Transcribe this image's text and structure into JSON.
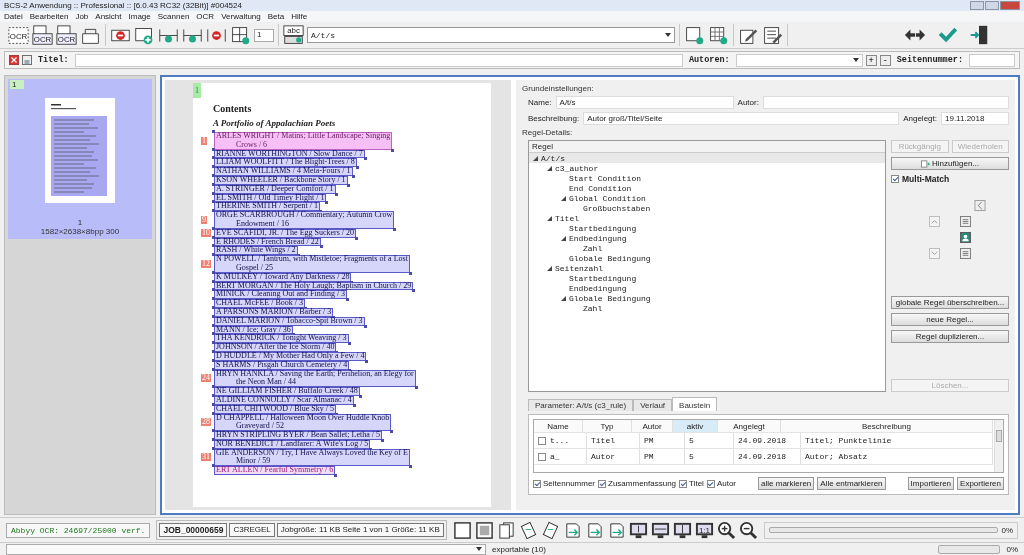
{
  "window": {
    "title": "BCS-2 Anwendung :: Professional :: [6.0.43 RC32 (32Bit)] #004524"
  },
  "menu": [
    "Datei",
    "Bearbeiten",
    "Job",
    "Ansicht",
    "Image",
    "Scannen",
    "OCR",
    "Verwaltung",
    "Beta",
    "Hilfe"
  ],
  "toolbar": {
    "groups": [
      [
        {
          "kind": "ocr-frame",
          "text": "OCR"
        },
        {
          "kind": "ocr-page",
          "text": "OCR"
        },
        {
          "kind": "ocr-page",
          "text": "OCR"
        },
        {
          "kind": "tray"
        }
      ],
      [
        {
          "kind": "region-minus"
        },
        {
          "kind": "region-plus"
        },
        {
          "kind": "region-right"
        },
        {
          "kind": "region-left"
        },
        {
          "kind": "region-stop"
        },
        {
          "kind": "region-grid"
        }
      ],
      [
        {
          "kind": "abc",
          "text": "abc"
        }
      ],
      [
        {
          "kind": "region-add"
        },
        {
          "kind": "grid-play"
        }
      ],
      [
        {
          "kind": "pencil"
        },
        {
          "kind": "list-edit"
        }
      ]
    ],
    "spinner": "1",
    "combo": "A/t/s",
    "right": [
      {
        "kind": "swap"
      },
      {
        "kind": "check"
      },
      {
        "kind": "exit"
      }
    ]
  },
  "title_row": {
    "title_label": "Titel:",
    "authors_label": "Autoren:",
    "plus": "+",
    "minus": "-",
    "page_label": "Seitennummer:"
  },
  "thumbnails": [
    {
      "tag": "1",
      "number": "1",
      "info": "1582×2638×8bpp 300",
      "selected": true
    }
  ],
  "page": {
    "marker": "1",
    "heading": "Contents",
    "subtitle": "A Portfolio of Appalachian Poets",
    "entries": [
      {
        "lines": [
          "ARLES WRIGHT / Matins; Little Landscape; Singing",
          "Crows / 6"
        ],
        "badge": "1",
        "selected": true,
        "flagged": false
      },
      {
        "lines": [
          "RIANNE WORTHINGTON / Slow Dance / 7"
        ],
        "selected": false,
        "flagged": false
      },
      {
        "lines": [
          "LLIAM WOOLFITT / The Blight-Trees / 8"
        ],
        "selected": false,
        "flagged": false
      },
      {
        "lines": [
          "NATHAN WILLIAMS / 4 Meta-Fours / 1"
        ],
        "selected": false,
        "flagged": false
      },
      {
        "lines": [
          "KSON WHEELER / Backbone Story / 1"
        ],
        "selected": false,
        "flagged": false
      },
      {
        "lines": [
          "A. STRINGER / Deeper Comfort / 1"
        ],
        "selected": false,
        "flagged": false
      },
      {
        "lines": [
          "EL SMITH / Old Timey Flight / 1"
        ],
        "selected": false,
        "flagged": false
      },
      {
        "lines": [
          "THERINE SMITH / Serpent / 1"
        ],
        "selected": false,
        "flagged": false
      },
      {
        "lines": [
          "ORGE SCARBROUGH / Commentary; Autumn Crow",
          "Endowment / 16"
        ],
        "badge": "9",
        "selected": false,
        "flagged": false
      },
      {
        "lines": [
          "EVE SCAFIDI, JR. / The Egg Suckers / 20"
        ],
        "badge": "10",
        "selected": false,
        "flagged": false
      },
      {
        "lines": [
          "E RHODES / French Bread / 22"
        ],
        "selected": false,
        "flagged": false
      },
      {
        "lines": [
          "RASH / White Wings / 2"
        ],
        "selected": false,
        "flagged": false
      },
      {
        "lines": [
          "N POWELL / Tantrum, with Mistletoe; Fragments of a Lost",
          "Gospel / 25"
        ],
        "badge": "12",
        "selected": false,
        "flagged": false
      },
      {
        "lines": [
          "K MULKEY / Toward Any Darkness / 28"
        ],
        "selected": false,
        "flagged": false
      },
      {
        "lines": [
          "BERT MORGAN / The Holy Laugh; Baptism in Church / 29"
        ],
        "selected": false,
        "flagged": false
      },
      {
        "lines": [
          "MINICK / Cleaning Out and Finding / 3"
        ],
        "selected": false,
        "flagged": false
      },
      {
        "lines": [
          "CHAEL McFEE / Book / 3"
        ],
        "selected": false,
        "flagged": false
      },
      {
        "lines": [
          "A PARSONS MARION / Barber / 3"
        ],
        "selected": false,
        "flagged": false
      },
      {
        "lines": [
          "DANIEL MARION / Tobacco-Spit Brown / 3"
        ],
        "selected": false,
        "flagged": false
      },
      {
        "lines": [
          "MANN / Ice; Gray / 36"
        ],
        "selected": false,
        "flagged": false
      },
      {
        "lines": [
          "THA KENDRICK / Tonight Weaving / 3"
        ],
        "selected": false,
        "flagged": false
      },
      {
        "lines": [
          "JOHNSON / After the Ice Storm / 40"
        ],
        "selected": false,
        "flagged": false
      },
      {
        "lines": [
          "D HUDDLE / My Mother Had Only a Few / 4"
        ],
        "selected": false,
        "flagged": false
      },
      {
        "lines": [
          "S HARMS / Pisgah Church Cemetery / 4"
        ],
        "selected": false,
        "flagged": false
      },
      {
        "lines": [
          "HRYN HANKLA / Saving the Earth; Perihelion, an Elegy for",
          "the Neon Man / 44"
        ],
        "badge": "24",
        "selected": false,
        "flagged": false
      },
      {
        "lines": [
          "NE GILLIAM FISHER / Buffalo Creek / 48"
        ],
        "selected": false,
        "flagged": false
      },
      {
        "lines": [
          "ALDINE CONNOLLY / Scar Almanac / 4"
        ],
        "selected": false,
        "flagged": false
      },
      {
        "lines": [
          "CHAEL CHITWOOD / Blue Sky / 5"
        ],
        "selected": false,
        "flagged": false
      },
      {
        "lines": [
          "D CHAPPELL / Halloween Moon Over Huddle Knob",
          "Graveyard / 52"
        ],
        "badge": "28",
        "selected": false,
        "flagged": false
      },
      {
        "lines": [
          "HRYN STRIPLING BYER / Bean Sallet; Letha / 5"
        ],
        "selected": false,
        "flagged": false
      },
      {
        "lines": [
          "NOR BENEDICT / Landfarer: A Wife's Log / 5"
        ],
        "selected": false,
        "flagged": false
      },
      {
        "lines": [
          "GIE ANDERSON / Try, I Have Always Loved the Key of E",
          "Minor / 59"
        ],
        "badge": "31",
        "selected": false,
        "flagged": false
      },
      {
        "lines": [
          "ERT ALLEN / Fearful Symmetry / 6"
        ],
        "selected": false,
        "flagged": true
      }
    ]
  },
  "settings": {
    "group_label": "Grundeinstellungen:",
    "name_label": "Name:",
    "name": "A/t/s",
    "author_label": "Autor:",
    "desc_label": "Beschreibung:",
    "desc": "Autor groß/Titel/Seite",
    "created_label": "Angelegt:",
    "created": "19.11.2018"
  },
  "rules": {
    "group_label": "Regel-Details:",
    "header": "Regel",
    "tree": [
      {
        "label": "A/t/s",
        "selected": true,
        "children": [
          {
            "label": "c3_author",
            "selected": false,
            "children": [
              {
                "label": "Start Condition",
                "selected": false
              },
              {
                "label": "End Condition",
                "selected": false
              },
              {
                "label": "Global Condition",
                "selected": false,
                "children": [
                  {
                    "label": "Großbuchstaben",
                    "selected": false
                  }
                ]
              }
            ]
          },
          {
            "label": "Titel",
            "selected": false,
            "children": [
              {
                "label": "Startbedingung",
                "selected": false
              },
              {
                "label": "Endbedingung",
                "selected": false,
                "children": [
                  {
                    "label": "Zahl",
                    "selected": false
                  }
                ]
              },
              {
                "label": "Globale Bedingung",
                "selected": false
              }
            ]
          },
          {
            "label": "Seitenzahl",
            "selected": false,
            "children": [
              {
                "label": "Startbedingung",
                "selected": false
              },
              {
                "label": "Endbedingung",
                "selected": false
              },
              {
                "label": "Globale Bedingung",
                "selected": false,
                "children": [
                  {
                    "label": "Zahl",
                    "selected": false
                  }
                ]
              }
            ]
          }
        ]
      }
    ],
    "undo": {
      "label": "Rückgängig",
      "disabled": true
    },
    "redo": {
      "label": "Wiederholen",
      "disabled": true
    },
    "add": {
      "label": "Hinzufügen...",
      "disabled": false
    },
    "multi": {
      "label": "Multi-Match",
      "checked": true
    },
    "buttons": [
      {
        "label": "globale Regel überschreiben...",
        "disabled": false
      },
      {
        "label": "neue Regel...",
        "disabled": false
      },
      {
        "label": "Regel duplizieren...",
        "disabled": false
      }
    ],
    "delete": {
      "label": "Löschen...",
      "disabled": true
    }
  },
  "tabs": [
    {
      "label": "Parameter: A/t/s (c3_rule)",
      "selected": false
    },
    {
      "label": "Verlauf",
      "selected": false
    },
    {
      "label": "Baustein",
      "selected": true
    }
  ],
  "table": {
    "columns": [
      {
        "label": "Name",
        "sorted": false
      },
      {
        "label": "Typ",
        "sorted": false
      },
      {
        "label": "Autor",
        "sorted": false
      },
      {
        "label": "aktiv",
        "sorted": true
      },
      {
        "label": "Angelegt",
        "sorted": false
      },
      {
        "label": "Beschreibung",
        "sorted": false
      }
    ],
    "rows": [
      {
        "checked": false,
        "cells": [
          "t...",
          "Titel",
          "PM",
          "5",
          "24.09.2018",
          "Titel; Punktelinie"
        ]
      },
      {
        "checked": false,
        "cells": [
          "a_",
          "Autor",
          "PM",
          "5",
          "24.09.2018",
          "Autor; Absatz"
        ]
      }
    ]
  },
  "filters": [
    {
      "label": "Seitennummer",
      "checked": true
    },
    {
      "label": "Zusammenfassung",
      "checked": true
    },
    {
      "label": "Titel",
      "checked": true
    },
    {
      "label": "Autor",
      "checked": true
    }
  ],
  "table_buttons": [
    "alle markieren",
    "Alle entmarkieren"
  ],
  "io_buttons": [
    "Importieren",
    "Exportieren"
  ],
  "status": {
    "ocr": "Abbyy OCR: 24697/25000 verf.",
    "job": "JOB_00000659",
    "rule": "C3REGEL",
    "size": "Jobgröße: 11 KB Seite 1 von 1 Größe: 11 KB",
    "icons": [
      {
        "kind": "frame"
      },
      {
        "kind": "frame-grey"
      },
      {
        "kind": "pages"
      },
      {
        "kind": "rotate-left"
      },
      {
        "kind": "rotate-right"
      },
      {
        "kind": "page-out"
      },
      {
        "kind": "page-mid"
      },
      {
        "kind": "page-in"
      },
      {
        "kind": "fit-height"
      },
      {
        "kind": "fit-width"
      },
      {
        "kind": "fit-two"
      },
      {
        "kind": "fit-one"
      },
      {
        "kind": "zoom-in"
      },
      {
        "kind": "zoom-out"
      }
    ],
    "one_to_one": "1:1",
    "level": 0,
    "percent": "0%"
  },
  "bottom": {
    "export": "exportable (10)",
    "level": 0,
    "percent": "0%"
  }
}
